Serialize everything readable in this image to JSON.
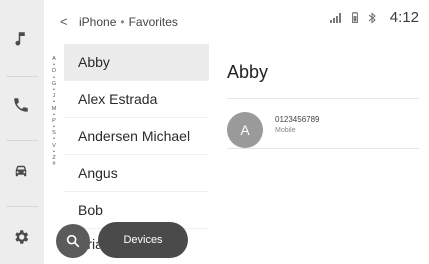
{
  "header": {
    "device": "iPhone",
    "separator": "•",
    "section": "Favorites",
    "clock": "4:12"
  },
  "rail": {
    "items": [
      {
        "icon": "music-note-icon"
      },
      {
        "icon": "phone-icon"
      },
      {
        "icon": "car-icon"
      },
      {
        "icon": "gear-icon"
      }
    ]
  },
  "az_index": [
    "A",
    "•",
    "D",
    "•",
    "G",
    "•",
    "J",
    "•",
    "M",
    "•",
    "P",
    "•",
    "S",
    "•",
    "V",
    "•",
    "Z",
    "#"
  ],
  "contacts": [
    {
      "name": "Abby",
      "selected": true
    },
    {
      "name": "Alex Estrada"
    },
    {
      "name": "Andersen Michael"
    },
    {
      "name": "Angus"
    },
    {
      "name": "Bob"
    }
  ],
  "partial_contact": "Bria",
  "detail": {
    "name": "Abby",
    "avatar_initial": "A",
    "numbers": [
      {
        "number": "0123456789",
        "type": "Mobile"
      }
    ]
  },
  "controls": {
    "devices_label": "Devices"
  },
  "colors": {
    "rail_bg": "#ededed",
    "selected_row_bg": "#ececec",
    "button_dark": "#4a4a4a",
    "avatar_bg": "#9a9a9a"
  }
}
